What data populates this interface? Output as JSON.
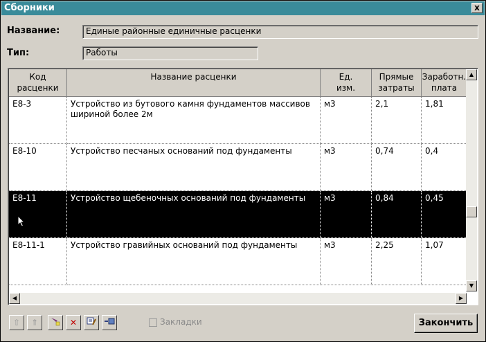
{
  "window": {
    "title": "Сборники",
    "close_symbol": "x"
  },
  "form": {
    "name_label": "Название:",
    "name_value": "Единые районные единичные расценки",
    "type_label": "Тип:",
    "type_value": "Работы"
  },
  "table": {
    "columns": [
      "Код\nрасценки",
      "Название расценки",
      "Ед.\nизм.",
      "Прямые\nзатраты",
      "Заработн.\nплата"
    ],
    "rows": [
      {
        "code": "Е8-3",
        "name": "Устройство из бутового камня фундаментов массивов шириной более 2м",
        "unit": "м3",
        "direct": "2,1",
        "wage": "1,81",
        "selected": false
      },
      {
        "code": "Е8-10",
        "name": "Устройство песчаных оснований под фундаменты",
        "unit": "м3",
        "direct": "0,74",
        "wage": "0,4",
        "selected": false
      },
      {
        "code": "Е8-11",
        "name": "Устройство щебеночных оснований под фундаменты",
        "unit": "м3",
        "direct": "0,84",
        "wage": "0,45",
        "selected": true
      },
      {
        "code": "Е8-11-1",
        "name": "Устройство гравийных оснований под фундаменты",
        "unit": "м3",
        "direct": "2,25",
        "wage": "1,07",
        "selected": false
      }
    ]
  },
  "toolbar": {
    "bookmarks_label": "Закладки",
    "bookmarks_checked": false,
    "buttons": [
      "up-icon",
      "up-alt-icon",
      "filter-icon",
      "delete-icon",
      "edit-icon",
      "insert-icon"
    ]
  },
  "finish_label": "Закончить",
  "colors": {
    "titlebar": "#3a8b9a",
    "face": "#d4d0c8",
    "selected_row": "#000000",
    "delete": "#c00000"
  }
}
